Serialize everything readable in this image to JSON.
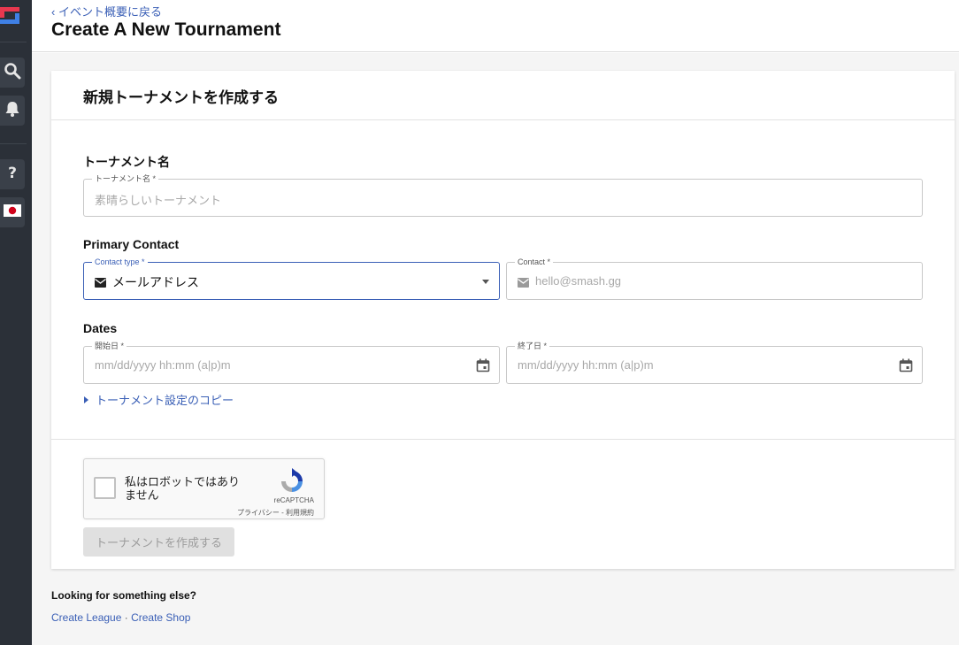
{
  "header": {
    "back_link": "‹ イベント概要に戻る",
    "title": "Create A New Tournament"
  },
  "card": {
    "title": "新規トーナメントを作成する",
    "tournament_name": {
      "section": "トーナメント名",
      "label": "トーナメント名 *",
      "placeholder": "素晴らしいトーナメント"
    },
    "primary_contact": {
      "section": "Primary Contact",
      "type_label": "Contact type *",
      "type_value": "メールアドレス",
      "contact_label": "Contact *",
      "contact_placeholder": "hello@smash.gg"
    },
    "dates": {
      "section": "Dates",
      "start_label": "開始日 *",
      "start_placeholder": "mm/dd/yyyy hh:mm (a|p)m",
      "end_label": "終了日 *",
      "end_placeholder": "mm/dd/yyyy hh:mm (a|p)m"
    },
    "copy_settings": "トーナメント設定のコピー",
    "captcha": {
      "text": "私はロボットではありません",
      "brand": "reCAPTCHA",
      "links": "プライバシー - 利用規約"
    },
    "submit": "トーナメントを作成する"
  },
  "footer": {
    "question": "Looking for something else?",
    "link_league": "Create League",
    "separator": " · ",
    "link_shop": "Create Shop"
  },
  "colors": {
    "rail": "#2b3038",
    "link": "#3a5fb6",
    "accent_red": "#e8384f",
    "accent_blue": "#3f80e5"
  }
}
